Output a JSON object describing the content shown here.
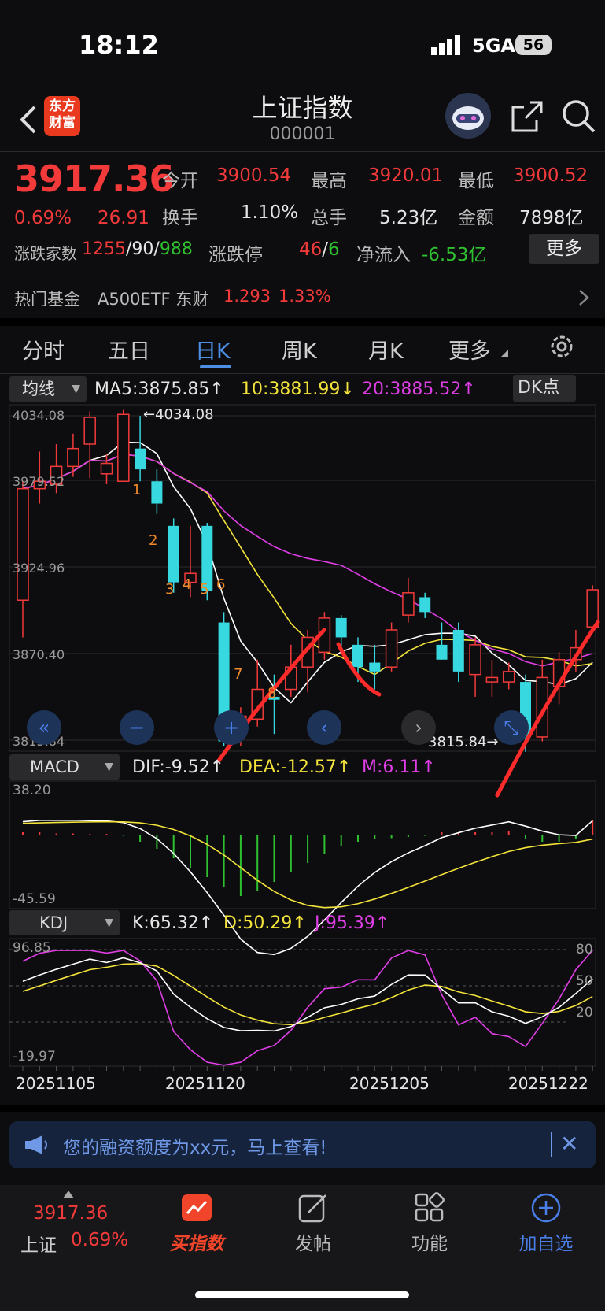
{
  "status": {
    "time": "18:12",
    "network": "5GA",
    "battery": "56"
  },
  "header": {
    "title": "上证指数",
    "code": "000001",
    "logo_line1": "东方",
    "logo_line2": "财富"
  },
  "quote": {
    "price": "3917.36",
    "change_pct": "0.69%",
    "change": "26.91",
    "open_label": "今开",
    "open": "3900.54",
    "high_label": "最高",
    "high": "3920.01",
    "low_label": "最低",
    "low": "3900.52",
    "turnover_label": "换手",
    "turnover": "1.10%",
    "volume_label": "总手",
    "volume": "5.23亿",
    "amount_label": "金额",
    "amount": "7898亿",
    "breadth_label": "涨跌家数",
    "breadth_up": "1255",
    "breadth_flat": "90",
    "breadth_down": "988",
    "limit_label": "涨跌停",
    "limit_up": "46",
    "limit_down": "6",
    "netflow_label": "净流入",
    "netflow": "-6.53亿",
    "more_label": "更多"
  },
  "fund": {
    "label": "热门基金",
    "name": "A500ETF 东财",
    "price": "1.293",
    "pct": "1.33%"
  },
  "tabs": [
    "分时",
    "五日",
    "日K",
    "周K",
    "月K",
    "更多"
  ],
  "ma": {
    "selector": "均线",
    "ma5": "MA5:3875.85↑",
    "ma10": "10:3881.99↓",
    "ma20": "20:3885.52↑",
    "dk": "DK点"
  },
  "price_axis": [
    "4034.08",
    "3979.52",
    "3924.96",
    "3870.40",
    "3815.84"
  ],
  "high_marker": "←4034.08",
  "low_marker": "3815.84→",
  "macd": {
    "selector": "MACD",
    "dif": "DIF:-9.52↑",
    "dea": "DEA:-12.57↑",
    "m": "M:6.11↑",
    "top": "38.20",
    "bottom": "-45.59"
  },
  "kdj": {
    "selector": "KDJ",
    "k": "K:65.32↑",
    "d": "D:50.29↑",
    "j": "J:95.39↑",
    "top": "96.85",
    "bottom": "-19.97",
    "r80": "80",
    "r50": "50",
    "r20": "20"
  },
  "dates": [
    "20251105",
    "20251120",
    "20251205",
    "20251222"
  ],
  "td_labels": [
    "1",
    "2",
    "3",
    "4",
    "5",
    "6",
    "7",
    "8"
  ],
  "chart_data": {
    "type": "candlestick",
    "candles": [
      {
        "o": 3910,
        "h": 3990,
        "l": 3885,
        "c": 3985
      },
      {
        "o": 3985,
        "h": 4010,
        "l": 3975,
        "c": 3990
      },
      {
        "o": 3988,
        "h": 4015,
        "l": 3982,
        "c": 4000
      },
      {
        "o": 4000,
        "h": 4022,
        "l": 3993,
        "c": 4012
      },
      {
        "o": 4015,
        "h": 4037,
        "l": 3992,
        "c": 4033
      },
      {
        "o": 3995,
        "h": 4008,
        "l": 3988,
        "c": 4002
      },
      {
        "o": 3990,
        "h": 4038,
        "l": 3990,
        "c": 4035
      },
      {
        "o": 4012,
        "h": 4034,
        "l": 3990,
        "c": 3998
      },
      {
        "o": 3990,
        "h": 3998,
        "l": 3968,
        "c": 3975
      },
      {
        "o": 3960,
        "h": 3965,
        "l": 3915,
        "c": 3922
      },
      {
        "o": 3922,
        "h": 3960,
        "l": 3912,
        "c": 3928
      },
      {
        "o": 3960,
        "h": 3962,
        "l": 3910,
        "c": 3916
      },
      {
        "o": 3895,
        "h": 3902,
        "l": 3812,
        "c": 3815
      },
      {
        "o": 3822,
        "h": 3838,
        "l": 3812,
        "c": 3832
      },
      {
        "o": 3830,
        "h": 3870,
        "l": 3825,
        "c": 3850
      },
      {
        "o": 3845,
        "h": 3860,
        "l": 3820,
        "c": 3843
      },
      {
        "o": 3850,
        "h": 3880,
        "l": 3845,
        "c": 3865
      },
      {
        "o": 3865,
        "h": 3890,
        "l": 3848,
        "c": 3885
      },
      {
        "o": 3875,
        "h": 3902,
        "l": 3870,
        "c": 3898
      },
      {
        "o": 3898,
        "h": 3900,
        "l": 3874,
        "c": 3885
      },
      {
        "o": 3880,
        "h": 3885,
        "l": 3855,
        "c": 3865
      },
      {
        "o": 3868,
        "h": 3880,
        "l": 3850,
        "c": 3862
      },
      {
        "o": 3865,
        "h": 3895,
        "l": 3862,
        "c": 3890
      },
      {
        "o": 3900,
        "h": 3925,
        "l": 3895,
        "c": 3915
      },
      {
        "o": 3912,
        "h": 3915,
        "l": 3898,
        "c": 3902
      },
      {
        "o": 3880,
        "h": 3895,
        "l": 3870,
        "c": 3870
      },
      {
        "o": 3890,
        "h": 3895,
        "l": 3855,
        "c": 3862
      },
      {
        "o": 3860,
        "h": 3885,
        "l": 3845,
        "c": 3880
      },
      {
        "o": 3855,
        "h": 3870,
        "l": 3845,
        "c": 3858
      },
      {
        "o": 3855,
        "h": 3868,
        "l": 3850,
        "c": 3862
      },
      {
        "o": 3855,
        "h": 3860,
        "l": 3808,
        "c": 3818
      },
      {
        "o": 3818,
        "h": 3870,
        "l": 3815,
        "c": 3858
      },
      {
        "o": 3852,
        "h": 3875,
        "l": 3840,
        "c": 3870
      },
      {
        "o": 3870,
        "h": 3890,
        "l": 3862,
        "c": 3878
      },
      {
        "o": 3892,
        "h": 3920,
        "l": 3890,
        "c": 3917
      }
    ],
    "macd_hist": [
      1,
      1,
      0.5,
      0.5,
      0.3,
      0.3,
      -0.5,
      -3,
      -6,
      -10,
      -14,
      -18,
      -22,
      -26,
      -24,
      -20,
      -16,
      -12,
      -8,
      -5,
      -3,
      -2,
      -1.5,
      -1,
      -0.5,
      1,
      0.5,
      1,
      1,
      1.5,
      -2,
      -3,
      -3,
      -2,
      6
    ],
    "ylim": [
      3815.84,
      4034.08
    ]
  },
  "banner": {
    "text": "您的融资额度为xx元，马上查看!"
  },
  "bottom_nav": {
    "price": "3917.36",
    "index_name": "上证",
    "pct": "0.69%",
    "buy": "买指数",
    "post": "发帖",
    "func": "功能",
    "watch": "加自选"
  }
}
